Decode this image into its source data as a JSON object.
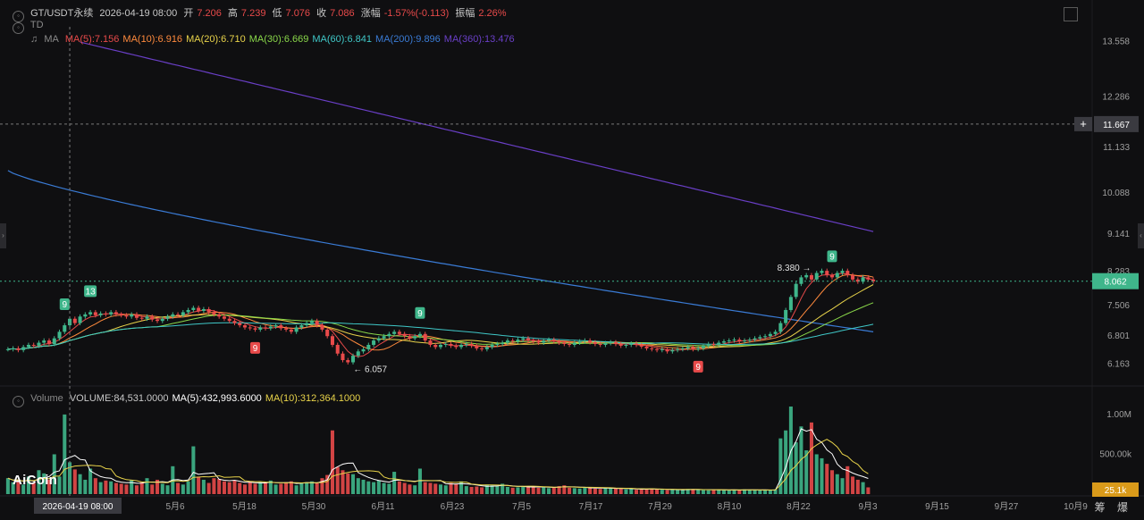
{
  "header": {
    "symbol": "GT/USDT永续",
    "datetime": "2026-04-19 08:00",
    "open_label": "开",
    "open": "7.206",
    "high_label": "高",
    "high": "7.239",
    "low_label": "低",
    "low": "7.076",
    "close_label": "收",
    "close": "7.086",
    "change_label": "涨幅",
    "change": "-1.57%(-0.113)",
    "amp_label": "振幅",
    "amp": "2.26%"
  },
  "td_label": "TD",
  "ma_row": {
    "label": "MA",
    "items": [
      {
        "text": "MA(5):7.156",
        "color": "#e84a4a"
      },
      {
        "text": "MA(10):6.916",
        "color": "#ff8a3d"
      },
      {
        "text": "MA(20):6.710",
        "color": "#e8d34a"
      },
      {
        "text": "MA(30):6.669",
        "color": "#8ad84a"
      },
      {
        "text": "MA(60):6.841",
        "color": "#3fc7c7"
      },
      {
        "text": "MA(200):9.896",
        "color": "#3a7bd5"
      },
      {
        "text": "MA(360):13.476",
        "color": "#6a3fc7"
      }
    ]
  },
  "volume_row": {
    "label": "Volume",
    "items": [
      {
        "text": "VOLUME:84,531.0000",
        "color": "#c8c8c8"
      },
      {
        "text": "MA(5):432,993.6000",
        "color": "#ffffff"
      },
      {
        "text": "MA(10):312,364.1000",
        "color": "#e8d34a"
      }
    ]
  },
  "logo_text": "AiCoin",
  "bottom_buttons": [
    "筹",
    "爆"
  ],
  "colors": {
    "up": "#3fb68b",
    "down": "#e84a4a",
    "bg": "#0f0f11",
    "axis_text": "#a0a0a0"
  },
  "chart_data": {
    "type": "candlestick",
    "price_axis": {
      "ylim": [
        5.8,
        13.9
      ],
      "ticks": [
        "13.558",
        "12.286",
        "11.133",
        "10.088",
        "9.141",
        "8.283",
        "7.506",
        "6.801",
        "6.163"
      ],
      "crosshair_price": "11.667",
      "last_price": "8.062"
    },
    "volume_axis": {
      "ylim": [
        0,
        1100000
      ],
      "ticks": [
        "1.00M",
        "500.00k"
      ],
      "last_volume": "25.1k"
    },
    "x_labels": [
      "5月6",
      "5月18",
      "5月30",
      "6月11",
      "6月23",
      "7月5",
      "7月17",
      "7月29",
      "8月10",
      "8月22",
      "9月3",
      "9月15",
      "9月27",
      "10月9"
    ],
    "crosshair_date": "2026-04-19 08:00",
    "annotations": {
      "high": "8.380",
      "low": "6.057"
    },
    "td_marks": [
      {
        "idx": 11,
        "text": "9",
        "kind": "up"
      },
      {
        "idx": 16,
        "text": "13",
        "kind": "up"
      },
      {
        "idx": 48,
        "text": "9",
        "kind": "down"
      },
      {
        "idx": 80,
        "text": "9",
        "kind": "up"
      },
      {
        "idx": 134,
        "text": "9",
        "kind": "down"
      },
      {
        "idx": 160,
        "text": "9",
        "kind": "up"
      }
    ],
    "close": [
      6.5,
      6.52,
      6.48,
      6.55,
      6.6,
      6.58,
      6.65,
      6.7,
      6.62,
      6.75,
      6.9,
      7.05,
      7.2,
      7.1,
      7.25,
      7.3,
      7.35,
      7.28,
      7.32,
      7.3,
      7.35,
      7.3,
      7.28,
      7.25,
      7.3,
      7.22,
      7.2,
      7.25,
      7.18,
      7.15,
      7.2,
      7.25,
      7.3,
      7.28,
      7.35,
      7.4,
      7.45,
      7.38,
      7.42,
      7.35,
      7.3,
      7.25,
      7.2,
      7.15,
      7.1,
      7.05,
      7.0,
      6.98,
      6.95,
      7.0,
      6.98,
      7.02,
      7.05,
      6.98,
      6.95,
      6.9,
      7.0,
      7.05,
      7.1,
      7.15,
      7.05,
      6.95,
      6.8,
      6.6,
      6.4,
      6.25,
      6.2,
      6.35,
      6.45,
      6.5,
      6.6,
      6.7,
      6.75,
      6.8,
      6.85,
      6.9,
      6.85,
      6.8,
      6.75,
      6.8,
      6.85,
      6.7,
      6.6,
      6.55,
      6.6,
      6.62,
      6.58,
      6.55,
      6.6,
      6.62,
      6.58,
      6.52,
      6.5,
      6.55,
      6.6,
      6.62,
      6.65,
      6.7,
      6.68,
      6.72,
      6.75,
      6.7,
      6.68,
      6.65,
      6.7,
      6.72,
      6.68,
      6.65,
      6.62,
      6.6,
      6.65,
      6.68,
      6.7,
      6.66,
      6.62,
      6.6,
      6.64,
      6.66,
      6.62,
      6.58,
      6.6,
      6.63,
      6.6,
      6.56,
      6.52,
      6.5,
      6.48,
      6.5,
      6.45,
      6.48,
      6.5,
      6.52,
      6.55,
      6.5,
      6.52,
      6.58,
      6.62,
      6.6,
      6.65,
      6.68,
      6.7,
      6.72,
      6.68,
      6.7,
      6.72,
      6.75,
      6.78,
      6.8,
      6.85,
      6.9,
      7.1,
      7.4,
      7.7,
      8.0,
      8.15,
      8.2,
      8.1,
      8.25,
      8.3,
      8.2,
      8.15,
      8.25,
      8.3,
      8.2,
      8.1,
      8.05,
      8.15,
      8.1,
      8.06
    ],
    "volume": [
      200000,
      150000,
      180000,
      120000,
      220000,
      140000,
      300000,
      260000,
      180000,
      500000,
      220000,
      1000000,
      400000,
      310000,
      250000,
      180000,
      320000,
      200000,
      150000,
      170000,
      160000,
      140000,
      130000,
      120000,
      180000,
      110000,
      150000,
      200000,
      120000,
      180000,
      130000,
      110000,
      350000,
      140000,
      120000,
      160000,
      600000,
      220000,
      180000,
      140000,
      200000,
      190000,
      160000,
      150000,
      170000,
      140000,
      120000,
      160000,
      130000,
      150000,
      140000,
      170000,
      120000,
      130000,
      150000,
      160000,
      110000,
      140000,
      150000,
      160000,
      140000,
      200000,
      240000,
      800000,
      340000,
      300000,
      260000,
      250000,
      200000,
      180000,
      160000,
      150000,
      170000,
      140000,
      130000,
      280000,
      160000,
      140000,
      120000,
      110000,
      320000,
      150000,
      140000,
      130000,
      120000,
      110000,
      140000,
      130000,
      160000,
      100000,
      90000,
      95000,
      85000,
      120000,
      110000,
      100000,
      130000,
      90000,
      80000,
      85000,
      95000,
      100000,
      90000,
      80000,
      85000,
      75000,
      90000,
      100000,
      110000,
      80000,
      75000,
      70000,
      90000,
      80000,
      70000,
      65000,
      75000,
      80000,
      70000,
      65000,
      60000,
      70000,
      55000,
      60000,
      65000,
      70000,
      60000,
      55000,
      50000,
      60000,
      55000,
      50000,
      65000,
      60000,
      55000,
      50000,
      48000,
      60000,
      55000,
      50000,
      45000,
      55000,
      50000,
      60000,
      55000,
      50000,
      45000,
      55000,
      50000,
      60000,
      700000,
      800000,
      1100000,
      650000,
      850000,
      550000,
      900000,
      500000,
      450000,
      380000,
      300000,
      250000,
      200000,
      350000,
      220000,
      180000,
      150000,
      84531
    ]
  }
}
